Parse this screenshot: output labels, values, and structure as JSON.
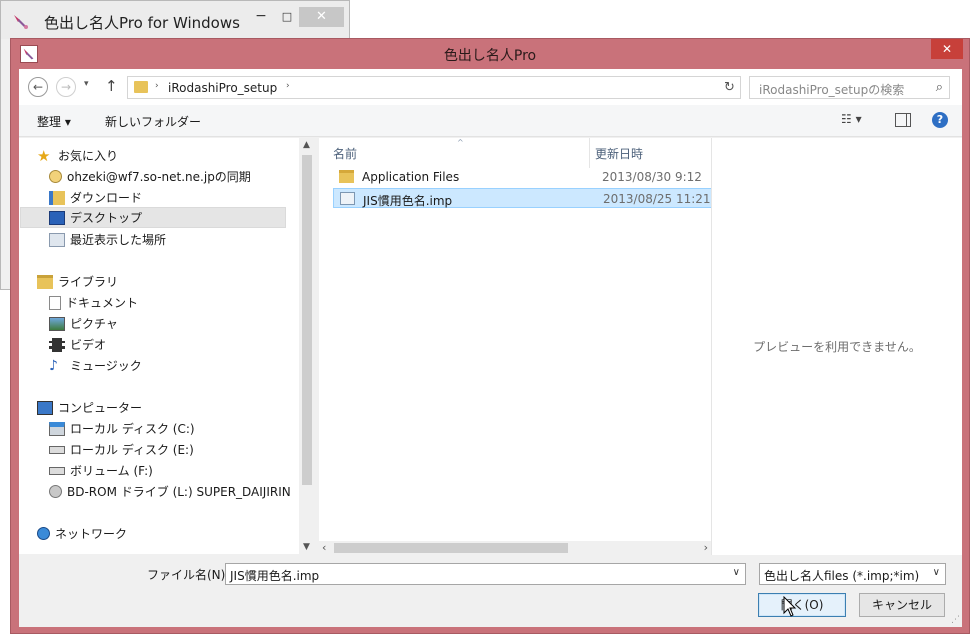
{
  "background_window": {
    "title": "色出し名人Pro for Windows",
    "minimize": "−",
    "maximize": "□",
    "close": "✕"
  },
  "dialog": {
    "title": "色出し名人Pro",
    "close": "✕"
  },
  "address_bar": {
    "back": "←",
    "forward": "→",
    "history_dropdown": "▾",
    "up": "↑",
    "crumb_separator": "›",
    "path": "iRodashiPro_setup",
    "path_dropdown": "∨",
    "refresh": "↻",
    "search_placeholder": "iRodashiPro_setupの検索",
    "search_icon": "⌕"
  },
  "toolbar": {
    "organize": "整理 ▾",
    "new_folder": "新しいフォルダー",
    "views": "☷ ▾",
    "help": "?"
  },
  "nav_pane": {
    "favorites": "お気に入り",
    "sync": "ohzeki@wf7.so-net.ne.jpの同期",
    "downloads": "ダウンロード",
    "desktop": "デスクトップ",
    "recent": "最近表示した場所",
    "libraries": "ライブラリ",
    "documents": "ドキュメント",
    "pictures": "ピクチャ",
    "videos": "ビデオ",
    "music": "ミュージック",
    "computer": "コンピューター",
    "drive_c": "ローカル ディスク (C:)",
    "drive_e": "ローカル ディスク (E:)",
    "drive_f": "ボリューム (F:)",
    "drive_l": "BD-ROM ドライブ (L:) SUPER_DAIJIRIN",
    "network": "ネットワーク"
  },
  "scroll": {
    "up": "▲",
    "down": "▼",
    "left": "‹",
    "right": "›"
  },
  "file_list": {
    "col_name": "名前",
    "col_date": "更新日時",
    "sort_indicator": "^",
    "files": [
      {
        "name": "Application Files",
        "date": "2013/08/30 9:12",
        "type": "folder"
      },
      {
        "name": "JIS慣用色名.imp",
        "date": "2013/08/25 11:21",
        "type": "file"
      }
    ]
  },
  "preview": {
    "message": "プレビューを利用できません。"
  },
  "footer": {
    "filename_label": "ファイル名(N):",
    "filename_value": "JIS慣用色名.imp",
    "filetype_value": "色出し名人files (*.imp;*im)",
    "dropdown_arrow": "∨",
    "open_button": "開く(O)",
    "cancel_button": "キャンセル",
    "grip": "⋰"
  },
  "colors": {
    "dialog_frame": "#c9727a",
    "close_button": "#c7403a",
    "selection": "#cce8ff"
  }
}
